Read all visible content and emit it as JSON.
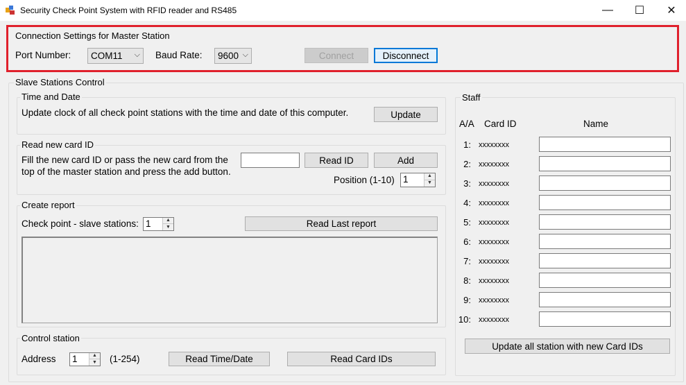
{
  "window": {
    "title": "Security Check Point System with RFID reader and RS485",
    "icon": "app-icon",
    "minimize": "—",
    "maximize": "☐",
    "close": "✕"
  },
  "highlight_color": "#e0202c",
  "connection": {
    "group_title": "Connection Settings for Master Station",
    "port_label": "Port Number:",
    "port_value": "COM11",
    "baud_label": "Baud Rate:",
    "baud_value": "9600",
    "connect_label": "Connect",
    "disconnect_label": "Disconnect"
  },
  "slave": {
    "group_title": "Slave Stations Control",
    "time_date": {
      "group_title": "Time and Date",
      "description": "Update clock of all check point stations with the time and date of this computer.",
      "update_label": "Update"
    },
    "read_card": {
      "group_title": "Read new card ID",
      "description_line1": "Fill the new card ID or pass the new card from the",
      "description_line2": "top of the master station and press the add button.",
      "card_id_value": "",
      "read_id_label": "Read ID",
      "add_label": "Add",
      "position_label": "Position (1-10)",
      "position_value": "1"
    },
    "report": {
      "group_title": "Create report",
      "checkpoint_label": "Check point - slave stations:",
      "checkpoint_value": "1",
      "read_last_label": "Read Last report",
      "report_text": ""
    },
    "control": {
      "group_title": "Control station",
      "address_label": "Address",
      "address_value": "1",
      "range_label": "(1-254)",
      "read_time_label": "Read Time/Date",
      "read_cards_label": "Read Card IDs"
    }
  },
  "staff": {
    "group_title": "Staff",
    "col_aa": "A/A",
    "col_card": "Card ID",
    "col_name": "Name",
    "rows": [
      {
        "num": "1:",
        "card": "xxxxxxxx",
        "name": ""
      },
      {
        "num": "2:",
        "card": "xxxxxxxx",
        "name": ""
      },
      {
        "num": "3:",
        "card": "xxxxxxxx",
        "name": ""
      },
      {
        "num": "4:",
        "card": "xxxxxxxx",
        "name": ""
      },
      {
        "num": "5:",
        "card": "xxxxxxxx",
        "name": ""
      },
      {
        "num": "6:",
        "card": "xxxxxxxx",
        "name": ""
      },
      {
        "num": "7:",
        "card": "xxxxxxxx",
        "name": ""
      },
      {
        "num": "8:",
        "card": "xxxxxxxx",
        "name": ""
      },
      {
        "num": "9:",
        "card": "xxxxxxxx",
        "name": ""
      },
      {
        "num": "10:",
        "card": "xxxxxxxx",
        "name": ""
      }
    ],
    "update_all_label": "Update all station with new Card IDs"
  }
}
